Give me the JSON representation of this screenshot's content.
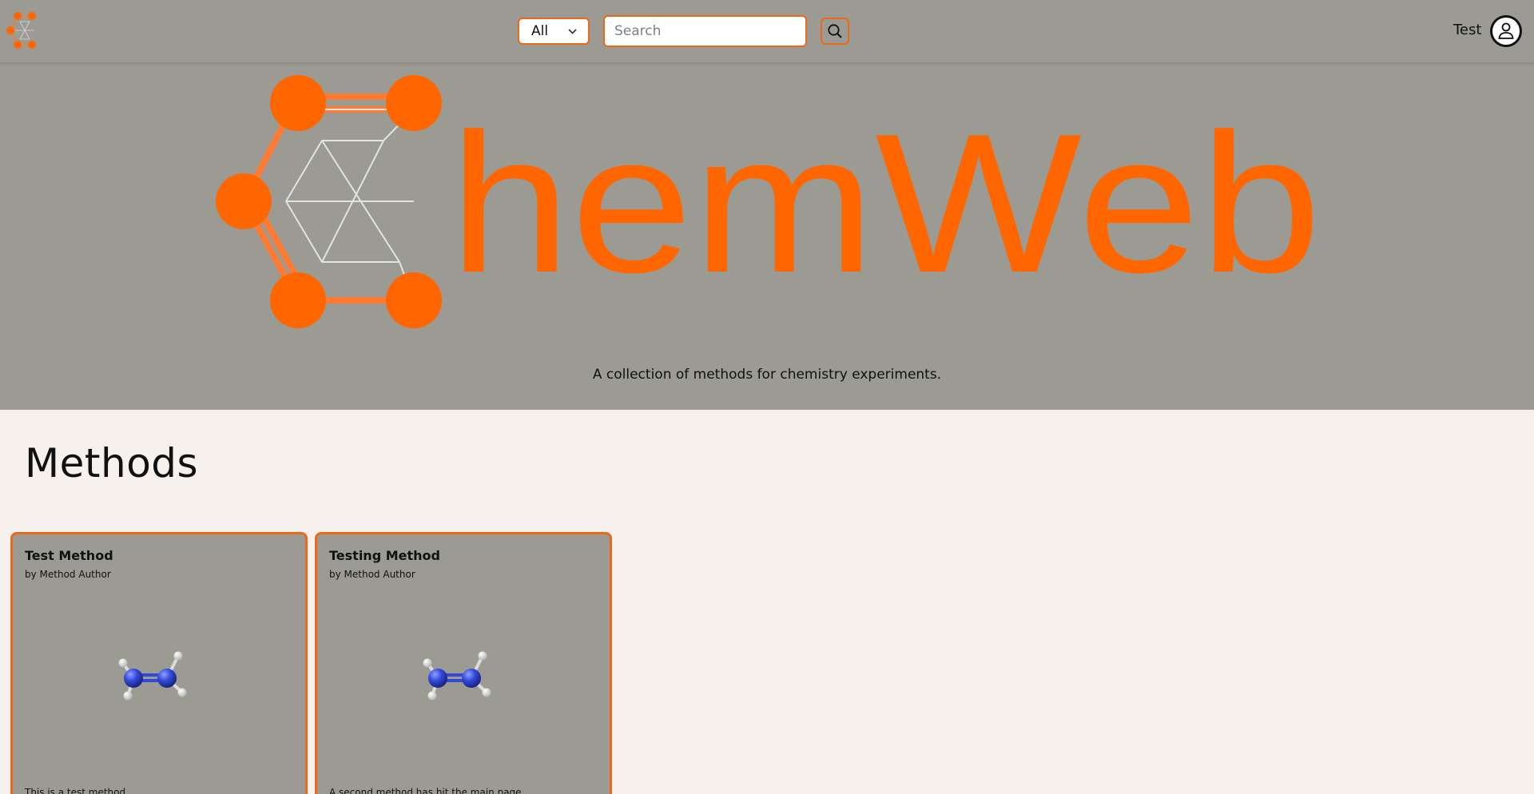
{
  "header": {
    "logo_icon": "chemweb-hexagon-logo",
    "search_scope": "All",
    "search_placeholder": "Search",
    "search_icon": "magnifier-icon",
    "user_name": "Test",
    "user_icon": "user-avatar-icon"
  },
  "hero": {
    "logo_text": "hemWeb",
    "tagline": "A collection of methods for chemistry experiments."
  },
  "methods": {
    "heading": "Methods",
    "cards": [
      {
        "title": "Test Method",
        "author": "by Method Author",
        "description": "This is a test method.",
        "image": "molecule-render"
      },
      {
        "title": "Testing Method",
        "author": "by Method Author",
        "description": "A second method has hit the main page.",
        "image": "molecule-render"
      }
    ]
  },
  "colors": {
    "accent": "#ff6600",
    "accent_border": "#ea6a1a",
    "header_bg": "#9b9a93",
    "page_bg": "#f7f1ee",
    "atom_blue": "#3347d9",
    "atom_white": "#f2f2f2"
  }
}
